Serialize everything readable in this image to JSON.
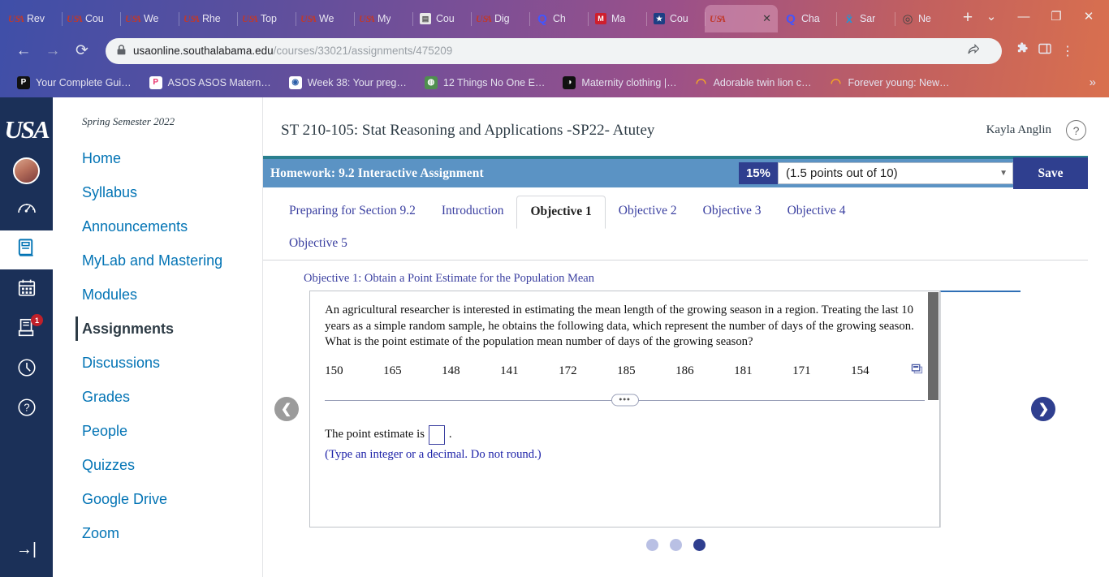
{
  "browser": {
    "tabs": [
      {
        "label": "Rev",
        "icon": "usa-favicon",
        "active": false
      },
      {
        "label": "Cou",
        "icon": "usa-favicon",
        "active": false
      },
      {
        "label": "We",
        "icon": "usa-favicon",
        "active": false
      },
      {
        "label": "Rhe",
        "icon": "usa-favicon",
        "active": false
      },
      {
        "label": "Top",
        "icon": "usa-favicon",
        "active": false
      },
      {
        "label": "We",
        "icon": "usa-favicon",
        "active": false
      },
      {
        "label": "My",
        "icon": "usa-favicon",
        "active": false
      },
      {
        "label": "Cou",
        "icon": "book-favicon",
        "active": false
      },
      {
        "label": "Dig",
        "icon": "usa-favicon",
        "active": false
      },
      {
        "label": "Ch",
        "icon": "quizlet-favicon",
        "active": false
      },
      {
        "label": "Ma",
        "icon": "mcgraw-favicon",
        "active": false
      },
      {
        "label": "Cou",
        "icon": "star-favicon",
        "active": false
      },
      {
        "label": "",
        "icon": "usa-favicon",
        "active": true
      },
      {
        "label": "Cha",
        "icon": "quizlet-favicon",
        "active": false
      },
      {
        "label": "Sar",
        "icon": "sheets-favicon",
        "active": false
      },
      {
        "label": "Ne",
        "icon": "globe-favicon",
        "active": false
      }
    ],
    "new_tab_label": "+",
    "tab_list_label": "⌄",
    "window_controls": {
      "minimize": "—",
      "maximize": "❐",
      "close": "✕"
    },
    "toolbar": {
      "back": "←",
      "forward": "→",
      "reload": "⟳",
      "lock_icon": "🔒",
      "url_domain": "usaonline.southalabama.edu",
      "url_path": "/courses/33021/assignments/475209",
      "share_icon": "share-icon",
      "star_icon": "☆",
      "extensions_icon": "puzzle-icon",
      "sidepanel_icon": "panel-icon",
      "menu_icon": "⋮"
    },
    "bookmarks": [
      {
        "label": "Your Complete Gui…",
        "color": "#111111",
        "glyph": "P"
      },
      {
        "label": "ASOS ASOS Matern…",
        "color": "#e8336d",
        "glyph": "P"
      },
      {
        "label": "Week 38: Your preg…",
        "color": "#ffffff",
        "glyph": "◉"
      },
      {
        "label": "12 Things No One E…",
        "color": "#4f8f4f",
        "glyph": "◍"
      },
      {
        "label": "Maternity clothing |…",
        "color": "#111111",
        "glyph": "◑"
      },
      {
        "label": "Adorable twin lion c…",
        "color": "#f5a623",
        "glyph": "◠"
      },
      {
        "label": "Forever young: New…",
        "color": "#f5a623",
        "glyph": "◠"
      }
    ],
    "bookmarks_overflow": "»"
  },
  "globalnav": {
    "logo": "USA",
    "items": [
      {
        "name": "account-avatar",
        "icon": "avatar"
      },
      {
        "name": "dashboard",
        "icon": "dashboard-icon"
      },
      {
        "name": "courses",
        "icon": "courses-book-icon",
        "active": true
      },
      {
        "name": "calendar",
        "icon": "calendar-icon"
      },
      {
        "name": "inbox",
        "icon": "inbox-icon",
        "badge": "1"
      },
      {
        "name": "history",
        "icon": "clock-icon"
      },
      {
        "name": "help",
        "icon": "question-icon"
      }
    ],
    "collapse_icon": "→|"
  },
  "coursenav": {
    "semester": "Spring Semester 2022",
    "items": [
      {
        "label": "Home",
        "active": false
      },
      {
        "label": "Syllabus",
        "active": false
      },
      {
        "label": "Announcements",
        "active": false
      },
      {
        "label": "MyLab and Mastering",
        "active": false
      },
      {
        "label": "Modules",
        "active": false
      },
      {
        "label": "Assignments",
        "active": true
      },
      {
        "label": "Discussions",
        "active": false
      },
      {
        "label": "Grades",
        "active": false
      },
      {
        "label": "People",
        "active": false
      },
      {
        "label": "Quizzes",
        "active": false
      },
      {
        "label": "Google Drive",
        "active": false
      },
      {
        "label": "Zoom",
        "active": false
      }
    ]
  },
  "header": {
    "course_title": "ST 210-105: Stat Reasoning and Applications -SP22- Atutey",
    "user_name": "Kayla Anglin",
    "help_icon": "?"
  },
  "homework": {
    "title": "Homework: 9.2 Interactive Assignment",
    "percent": "15%",
    "score_text": "(1.5 points out of 10)",
    "caret": "▼",
    "save_label": "Save"
  },
  "tabs": [
    {
      "label": "Preparing for Section 9.2",
      "active": false
    },
    {
      "label": "Introduction",
      "active": false
    },
    {
      "label": "Objective 1",
      "active": true
    },
    {
      "label": "Objective 2",
      "active": false
    },
    {
      "label": "Objective 3",
      "active": false
    },
    {
      "label": "Objective 4",
      "active": false
    },
    {
      "label": "Objective 5",
      "active": false
    }
  ],
  "question": {
    "objective_heading": "Objective 1: Obtain a Point Estimate for the Population Mean",
    "prompt": "An agricultural researcher is interested in estimating the mean length of the growing season in a region. Treating the last 10 years as a simple random sample, he obtains the following data, which represent the number of days of the growing season. What is the point estimate of the population mean number of days of the growing season?",
    "data_values": [
      "150",
      "165",
      "148",
      "141",
      "172",
      "185",
      "186",
      "181",
      "171",
      "154"
    ],
    "copy_icon": "copy-to-spreadsheet-icon",
    "divider_dots": "•••",
    "answer_label_prefix": "The point estimate is",
    "answer_label_suffix": ".",
    "answer_value": "",
    "answer_hint": "(Type an integer or a decimal. Do not round.)",
    "prev_arrow": "❮",
    "next_arrow": "❯",
    "pager_dots": [
      false,
      false,
      true
    ]
  }
}
